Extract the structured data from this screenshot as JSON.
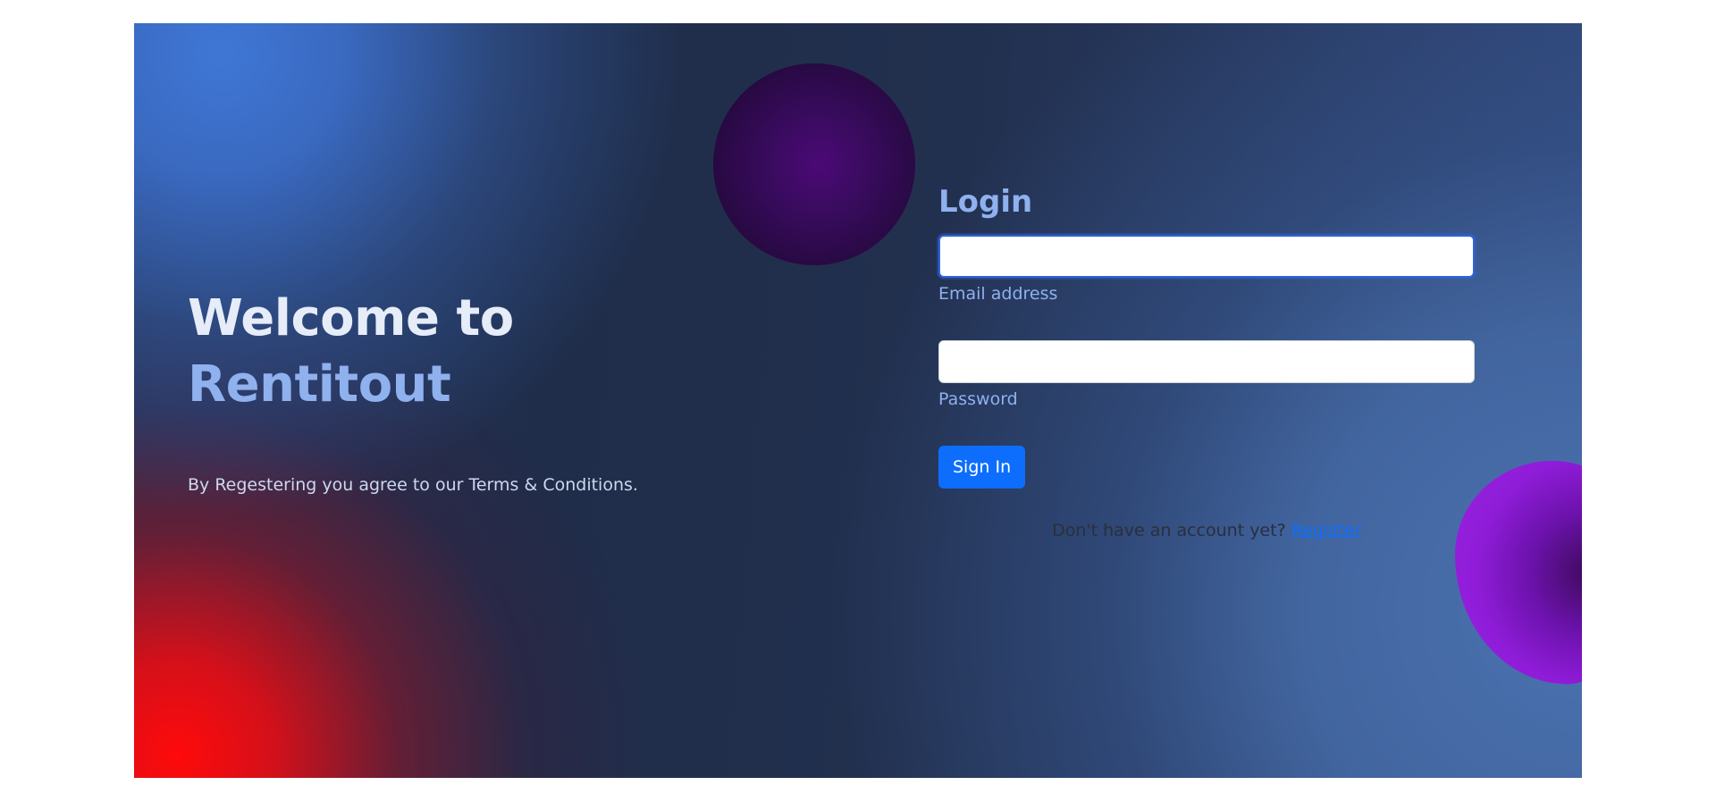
{
  "hero": {
    "welcome_line": "Welcome to",
    "brand_name": "Rentitout",
    "terms_text": "By Regestering you agree to our Terms & Conditions."
  },
  "login": {
    "title": "Login",
    "email_value": "",
    "email_label": "Email address",
    "password_value": "",
    "password_label": "Password",
    "signin_label": "Sign In",
    "no_account_text": "Don't have an account yet?",
    "register_link": "Register"
  },
  "colors": {
    "accent": "#0d6efd",
    "heading_light": "#8fb1ee",
    "background_dark": "#1f2d4a",
    "orb_purple": "#4b0a76",
    "blob_violet": "#9a24e0",
    "glow_red": "#ff0a0a",
    "glow_blue": "#3f77d6"
  }
}
